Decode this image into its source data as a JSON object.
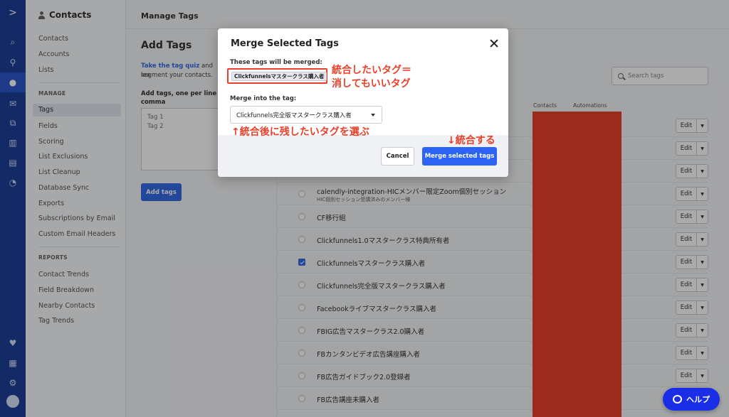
{
  "rail": {
    "icons": [
      "logo-icon",
      "search-icon",
      "location-icon",
      "contacts-icon",
      "email-icon",
      "automations-icon",
      "deals-icon",
      "lists-icon",
      "reports-icon",
      "heart-icon",
      "apps-icon",
      "settings-icon",
      "avatar"
    ]
  },
  "sidebar": {
    "title": "Contacts",
    "items": [
      "Contacts",
      "Accounts",
      "Lists"
    ],
    "manage_heading": "MANAGE",
    "manage_items": [
      "Tags",
      "Fields",
      "Scoring",
      "List Exclusions",
      "List Cleanup",
      "Database Sync",
      "Exports",
      "Subscriptions by Email",
      "Custom Email Headers"
    ],
    "reports_heading": "REPORTS",
    "reports_items": [
      "Contact Trends",
      "Field Breakdown",
      "Nearby Contacts",
      "Tag Trends"
    ]
  },
  "page": {
    "title": "Manage Tags",
    "add_tags": {
      "heading": "Add Tags",
      "quiz_link": "Take the tag quiz",
      "help_rest": "and lea",
      "help_line2": "segment your contacts.",
      "instruction_line1": "Add tags, one per line or",
      "instruction_line2": "comma",
      "placeholder": "Tag 1\nTag 2",
      "button": "Add tags"
    },
    "search_placeholder": "Search tags",
    "columns": {
      "contacts": "Contacts",
      "automations": "Automations"
    },
    "edit_label": "Edit",
    "rows": [
      {
        "name": "",
        "sub": "",
        "checked": false
      },
      {
        "name": "",
        "sub": "",
        "checked": false
      },
      {
        "name": "",
        "sub": "",
        "checked": false
      },
      {
        "name": "calendly-integration-HICメンバー限定Zoom個別セッション",
        "sub": "HIC個別セッション受講済みのメンバー様",
        "checked": false
      },
      {
        "name": "CF移行組",
        "sub": "",
        "checked": false
      },
      {
        "name": "Clickfunnels1.0マスタークラス特典所有者",
        "sub": "",
        "checked": false
      },
      {
        "name": "Clickfunnelsマスタークラス購入者",
        "sub": "",
        "checked": true
      },
      {
        "name": "Clickfunnels完全版マスタークラス購入者",
        "sub": "",
        "checked": false
      },
      {
        "name": "Facebookライブマスタークラス購入者",
        "sub": "",
        "checked": false
      },
      {
        "name": "FBIG広告マスタークラス2.0購入者",
        "sub": "",
        "checked": false
      },
      {
        "name": "FBカンタンビデオ広告講座購入者",
        "sub": "",
        "checked": false
      },
      {
        "name": "FB広告ガイドブック2.0登録者",
        "sub": "",
        "checked": false
      },
      {
        "name": "FB広告講座未購入者",
        "sub": "",
        "checked": false
      }
    ]
  },
  "modal": {
    "title": "Merge Selected Tags",
    "merged_label": "These tags will be merged:",
    "merged_tag": "Clickfunnelsマスタークラス購入者",
    "into_label": "Merge into the tag:",
    "into_value": "Clickfunnels完全版マスタークラス購入者",
    "cancel": "Cancel",
    "merge": "Merge selected tags"
  },
  "annotations": {
    "line1": "統合したいタグ＝",
    "line2": "消してもいいタグ",
    "keep": "↑統合後に残したいタグを選ぶ",
    "merge": "↓統合する"
  },
  "help_button": "ヘルプ",
  "colors": {
    "accent": "#356ae6",
    "rail": "#1f3f99",
    "annotation": "#e8402a"
  }
}
